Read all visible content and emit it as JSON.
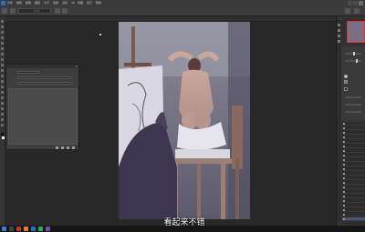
{
  "menubar": {
    "items": [
      "文件",
      "编辑",
      "图像",
      "图层",
      "文字",
      "选择",
      "滤镜",
      "3D",
      "视图",
      "窗口",
      "帮助"
    ]
  },
  "dialog": {
    "title": "",
    "rows": [
      {
        "label": "",
        "value": ""
      },
      {
        "label": "",
        "value": ""
      },
      {
        "label": "",
        "value": ""
      }
    ]
  },
  "subtitle": "看起来不错",
  "layers": {
    "rows": [
      "",
      "",
      "",
      "",
      "",
      "",
      "",
      "",
      "",
      "",
      "",
      "",
      "",
      "",
      "",
      "",
      "",
      "",
      "",
      "",
      "",
      ""
    ]
  },
  "taskbar": {
    "time": ""
  },
  "colors": {
    "accent": "#2d6fb8",
    "selected_layer": "#475a77"
  },
  "icons": {
    "app_logo": "ps-logo-icon",
    "close": "close-icon",
    "eye": "visibility-eye-icon"
  }
}
